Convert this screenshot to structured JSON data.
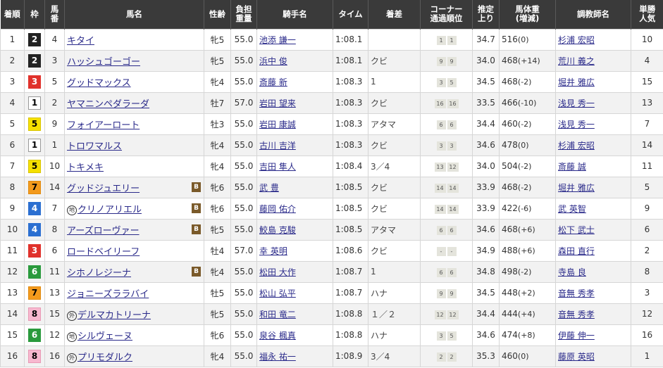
{
  "headers": [
    "着順",
    "枠",
    "馬番",
    "馬名",
    "性齢",
    "負担重量",
    "騎手名",
    "タイム",
    "着差",
    "コーナー通過順位",
    "推定上り",
    "馬体重(増減)",
    "調教師名",
    "単勝人気"
  ],
  "header_lines": {
    "umaban": [
      "馬",
      "番"
    ],
    "weight": [
      "負担",
      "重量"
    ],
    "corner": [
      "コーナー",
      "通過順位"
    ],
    "agari": [
      "推定",
      "上り"
    ],
    "bw": [
      "馬体重",
      "(増減)"
    ],
    "ninki": [
      "単勝",
      "人気"
    ]
  },
  "colors": {
    "header_bg": "#3a3a3a",
    "link": "#2a2a8a",
    "blinker": "#7a5a2a"
  },
  "rows": [
    {
      "rank": "1",
      "waku": "2",
      "umaban": "4",
      "mark": "",
      "name": "キタイ",
      "blinker": "",
      "sex_age": "牝5",
      "weight": "55.0",
      "jockey": "池添 謙一",
      "time": "1:08.1",
      "margin": "",
      "c1": "1",
      "c2": "1",
      "agari": "34.7",
      "bw": "516",
      "bwd": "(0)",
      "trainer": "杉浦 宏昭",
      "ninki": "10"
    },
    {
      "rank": "2",
      "waku": "2",
      "umaban": "3",
      "mark": "",
      "name": "ハッシュゴーゴー",
      "blinker": "",
      "sex_age": "牝5",
      "weight": "55.0",
      "jockey": "浜中 俊",
      "time": "1:08.1",
      "margin": "クビ",
      "c1": "9",
      "c2": "9",
      "agari": "34.0",
      "bw": "468",
      "bwd": "(+14)",
      "trainer": "荒川 義之",
      "ninki": "4"
    },
    {
      "rank": "3",
      "waku": "3",
      "umaban": "5",
      "mark": "",
      "name": "グッドマックス",
      "blinker": "",
      "sex_age": "牝4",
      "weight": "55.0",
      "jockey": "斎藤 新",
      "time": "1:08.3",
      "margin": "1",
      "c1": "3",
      "c2": "5",
      "agari": "34.5",
      "bw": "468",
      "bwd": "(-2)",
      "trainer": "堀井 雅広",
      "ninki": "15"
    },
    {
      "rank": "4",
      "waku": "1",
      "umaban": "2",
      "mark": "",
      "name": "ヤマニンペダラーダ",
      "blinker": "",
      "sex_age": "牡7",
      "weight": "57.0",
      "jockey": "岩田 望来",
      "time": "1:08.3",
      "margin": "クビ",
      "c1": "16",
      "c2": "16",
      "agari": "33.5",
      "bw": "466",
      "bwd": "(-10)",
      "trainer": "浅見 秀一",
      "ninki": "13"
    },
    {
      "rank": "5",
      "waku": "5",
      "umaban": "9",
      "mark": "",
      "name": "フォイアーロート",
      "blinker": "",
      "sex_age": "牡3",
      "weight": "55.0",
      "jockey": "岩田 康誠",
      "time": "1:08.3",
      "margin": "アタマ",
      "c1": "6",
      "c2": "6",
      "agari": "34.4",
      "bw": "460",
      "bwd": "(-2)",
      "trainer": "浅見 秀一",
      "ninki": "7"
    },
    {
      "rank": "6",
      "waku": "1",
      "umaban": "1",
      "mark": "",
      "name": "トロワマルス",
      "blinker": "",
      "sex_age": "牝4",
      "weight": "55.0",
      "jockey": "古川 吉洋",
      "time": "1:08.3",
      "margin": "クビ",
      "c1": "3",
      "c2": "3",
      "agari": "34.6",
      "bw": "478",
      "bwd": "(0)",
      "trainer": "杉浦 宏昭",
      "ninki": "14"
    },
    {
      "rank": "7",
      "waku": "5",
      "umaban": "10",
      "mark": "",
      "name": "トキメキ",
      "blinker": "",
      "sex_age": "牝4",
      "weight": "55.0",
      "jockey": "吉田 隼人",
      "time": "1:08.4",
      "margin": "3／4",
      "c1": "13",
      "c2": "12",
      "agari": "34.0",
      "bw": "504",
      "bwd": "(-2)",
      "trainer": "斎藤 誠",
      "ninki": "11"
    },
    {
      "rank": "8",
      "waku": "7",
      "umaban": "14",
      "mark": "",
      "name": "グッドジュエリー",
      "blinker": "B",
      "sex_age": "牝6",
      "weight": "55.0",
      "jockey": "武 豊",
      "time": "1:08.5",
      "margin": "クビ",
      "c1": "14",
      "c2": "14",
      "agari": "33.9",
      "bw": "468",
      "bwd": "(-2)",
      "trainer": "堀井 雅広",
      "ninki": "5"
    },
    {
      "rank": "9",
      "waku": "4",
      "umaban": "7",
      "mark": "地",
      "name": "クリノアリエル",
      "blinker": "B",
      "sex_age": "牝6",
      "weight": "55.0",
      "jockey": "藤岡 佑介",
      "time": "1:08.5",
      "margin": "クビ",
      "c1": "14",
      "c2": "14",
      "agari": "33.9",
      "bw": "422",
      "bwd": "(-6)",
      "trainer": "武 英智",
      "ninki": "9"
    },
    {
      "rank": "10",
      "waku": "4",
      "umaban": "8",
      "mark": "",
      "name": "アーズローヴァー",
      "blinker": "B",
      "sex_age": "牝5",
      "weight": "55.0",
      "jockey": "鮫島 克駿",
      "time": "1:08.5",
      "margin": "アタマ",
      "c1": "6",
      "c2": "6",
      "agari": "34.6",
      "bw": "468",
      "bwd": "(+6)",
      "trainer": "松下 武士",
      "ninki": "6"
    },
    {
      "rank": "11",
      "waku": "3",
      "umaban": "6",
      "mark": "",
      "name": "ロードベイリーフ",
      "blinker": "",
      "sex_age": "牡4",
      "weight": "57.0",
      "jockey": "幸 英明",
      "time": "1:08.6",
      "margin": "クビ",
      "c1": "-",
      "c2": "-",
      "agari": "34.9",
      "bw": "488",
      "bwd": "(+6)",
      "trainer": "森田 直行",
      "ninki": "2"
    },
    {
      "rank": "12",
      "waku": "6",
      "umaban": "11",
      "mark": "",
      "name": "シホノレジーナ",
      "blinker": "B",
      "sex_age": "牝4",
      "weight": "55.0",
      "jockey": "松田 大作",
      "time": "1:08.7",
      "margin": "1",
      "c1": "6",
      "c2": "6",
      "agari": "34.8",
      "bw": "498",
      "bwd": "(-2)",
      "trainer": "寺島 良",
      "ninki": "8"
    },
    {
      "rank": "13",
      "waku": "7",
      "umaban": "13",
      "mark": "",
      "name": "ジョニーズララバイ",
      "blinker": "",
      "sex_age": "牡5",
      "weight": "55.0",
      "jockey": "松山 弘平",
      "time": "1:08.7",
      "margin": "ハナ",
      "c1": "9",
      "c2": "9",
      "agari": "34.5",
      "bw": "448",
      "bwd": "(+2)",
      "trainer": "音無 秀孝",
      "ninki": "3"
    },
    {
      "rank": "14",
      "waku": "8",
      "umaban": "15",
      "mark": "外",
      "name": "デルマカトリーナ",
      "blinker": "",
      "sex_age": "牝5",
      "weight": "55.0",
      "jockey": "和田 竜二",
      "time": "1:08.8",
      "margin": "１／２",
      "c1": "12",
      "c2": "12",
      "agari": "34.4",
      "bw": "444",
      "bwd": "(+4)",
      "trainer": "音無 秀孝",
      "ninki": "12"
    },
    {
      "rank": "15",
      "waku": "6",
      "umaban": "12",
      "mark": "地",
      "name": "シルヴェーヌ",
      "blinker": "",
      "sex_age": "牝6",
      "weight": "55.0",
      "jockey": "泉谷 楓真",
      "time": "1:08.8",
      "margin": "ハナ",
      "c1": "3",
      "c2": "5",
      "agari": "34.6",
      "bw": "474",
      "bwd": "(+8)",
      "trainer": "伊藤 伸一",
      "ninki": "16"
    },
    {
      "rank": "16",
      "waku": "8",
      "umaban": "16",
      "mark": "外",
      "name": "プリモダルク",
      "blinker": "",
      "sex_age": "牝4",
      "weight": "55.0",
      "jockey": "福永 祐一",
      "time": "1:08.9",
      "margin": "3／4",
      "c1": "2",
      "c2": "2",
      "agari": "35.3",
      "bw": "460",
      "bwd": "(0)",
      "trainer": "藤原 英昭",
      "ninki": "1"
    }
  ]
}
